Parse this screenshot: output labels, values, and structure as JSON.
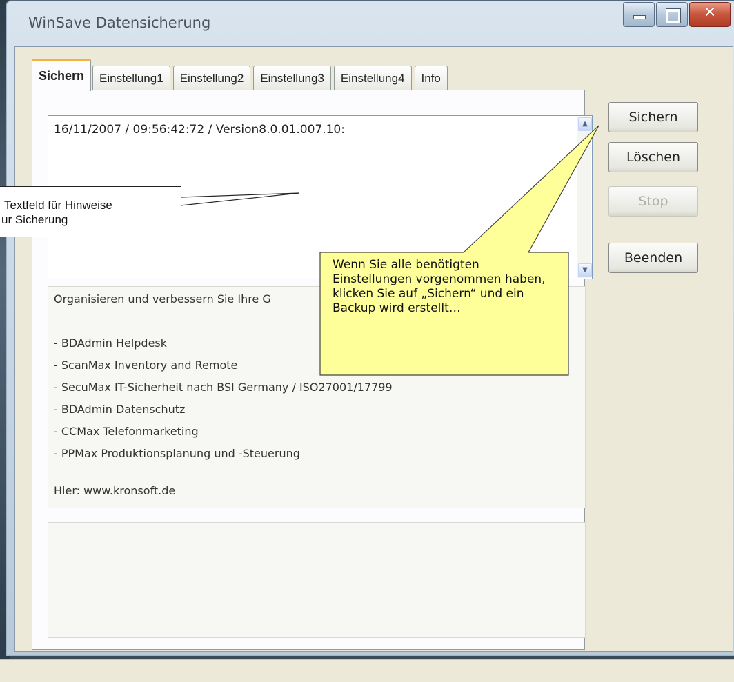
{
  "window": {
    "title": "WinSave Datensicherung"
  },
  "tabs": [
    {
      "label": "Sichern",
      "active": true
    },
    {
      "label": "Einstellung1",
      "active": false
    },
    {
      "label": "Einstellung2",
      "active": false
    },
    {
      "label": "Einstellung3",
      "active": false
    },
    {
      "label": "Einstellung4",
      "active": false
    },
    {
      "label": "Info",
      "active": false
    }
  ],
  "log": {
    "text": "16/11/2007 / 09:56:42:72 / Version8.0.01.007.10:"
  },
  "info_box": {
    "lines": [
      "Organisieren und verbessern Sie Ihre G",
      "",
      "- BDAdmin Helpdesk",
      "- ScanMax Inventory and Remote",
      "- SecuMax IT-Sicherheit nach BSI Germany / ISO27001/17799",
      "- BDAdmin Datenschutz",
      "- CCMax Telefonmarketing",
      "- PPMax Produktionsplanung und -Steuerung",
      "",
      "Hier:  www.kronsoft.de"
    ]
  },
  "buttons": {
    "sichern": "Sichern",
    "loeschen": "Löschen",
    "stop": "Stop",
    "beenden": "Beenden"
  },
  "callouts": {
    "left_line1": "Textfeld für Hinweise",
    "left_line2": "ur Sicherung",
    "yellow": "Wenn Sie alle benötigten Einstellungen vorgenommen haben, klicken Sie auf „Sichern“ und ein Backup wird erstellt…"
  },
  "colors": {
    "callout_fill": "#ffff99",
    "tab_accent": "#f2b23c",
    "close_button": "#c8553d"
  }
}
